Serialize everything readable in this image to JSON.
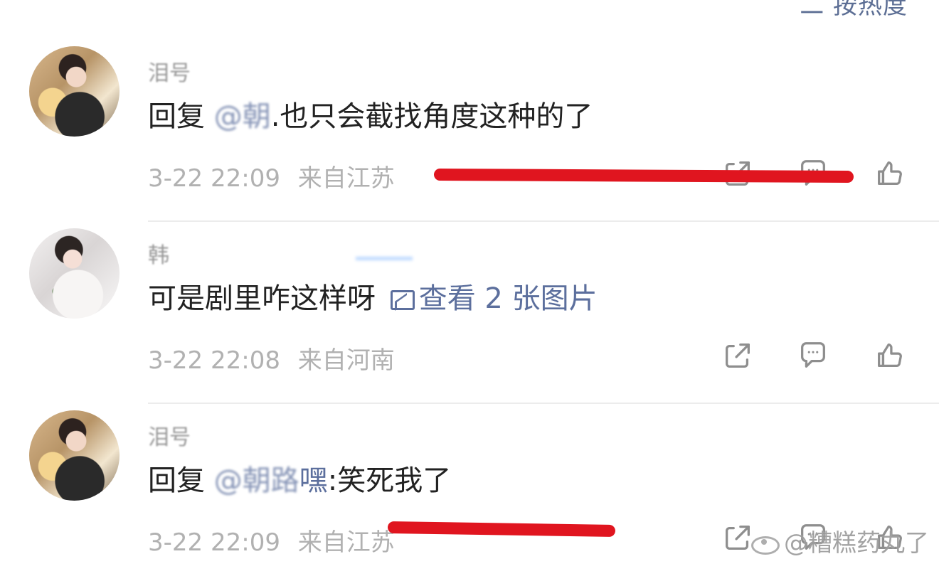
{
  "top": {
    "sort_label": "二 按热度"
  },
  "comments": [
    {
      "username": "泪号",
      "text_prefix": "回复 ",
      "mention": "@朝",
      "text_suffix": ".也只会截找角度这种的了",
      "date": "3-22 22:09",
      "location": "来自江苏"
    },
    {
      "username": "韩",
      "text": "可是剧里咋这样呀",
      "view_images_label": "查看 2 张图片",
      "date": "3-22 22:08",
      "location": "来自河南"
    },
    {
      "username": "泪号",
      "text_prefix": "回复 ",
      "mention": "@朝路",
      "mention_suffix": "嘿",
      "text_suffix": ":笑死我了",
      "date": "3-22 22:09",
      "location": "来自江苏"
    }
  ],
  "watermark": {
    "text": "@糟糕药丸了"
  },
  "colors": {
    "link": "#5c6f9d",
    "meta": "#b1b1b1",
    "icon": "#8e8e8e",
    "annotation": "#e0151f"
  },
  "icons": {
    "share": "share-icon",
    "comment": "comment-icon",
    "like": "thumbs-up-icon",
    "image": "image-icon"
  }
}
